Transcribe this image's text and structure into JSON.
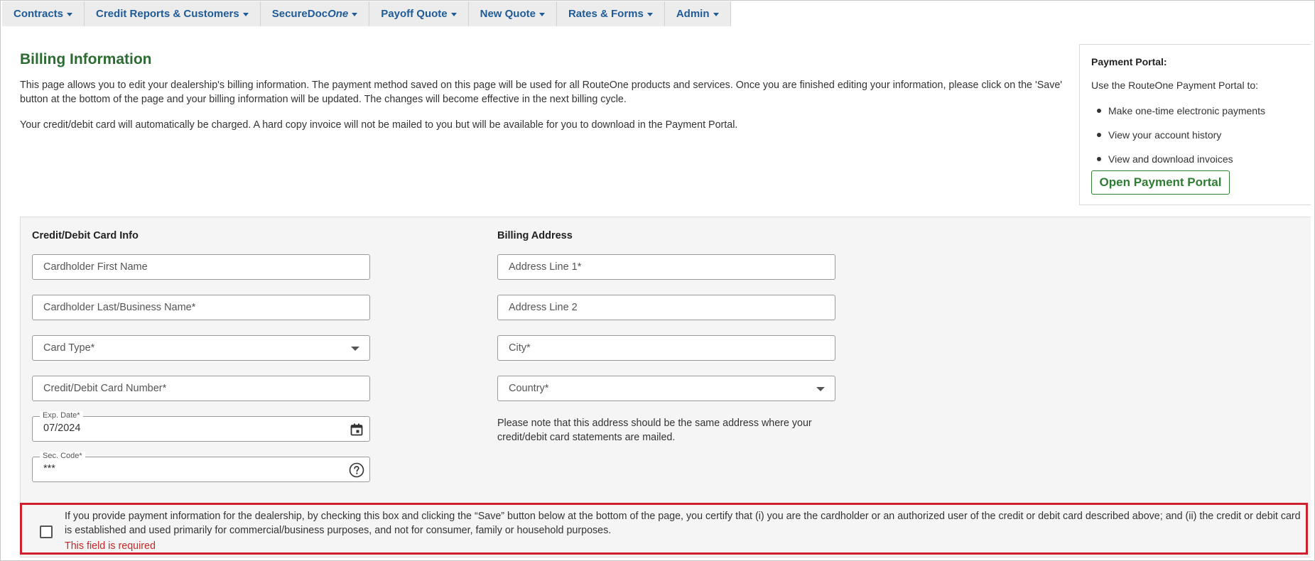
{
  "nav": [
    {
      "label": "Contracts"
    },
    {
      "label": "Credit Reports & Customers"
    },
    {
      "label_main": "SecureDoc",
      "label_italic": "One"
    },
    {
      "label": "Payoff Quote"
    },
    {
      "label": "New Quote"
    },
    {
      "label": "Rates & Forms"
    },
    {
      "label": "Admin"
    }
  ],
  "page": {
    "title": "Billing Information",
    "intro_1": "This page allows you to edit your dealership's billing information. The payment method saved on this page will be used for all RouteOne products and services. Once you are finished editing your information, please click on the 'Save' button at the bottom of the page and your billing information will be updated. The changes will become effective in the next billing cycle.",
    "intro_2": "Your credit/debit card will automatically be charged. A hard copy invoice will not be mailed to you but will be available for you to download in the Payment Portal."
  },
  "portal": {
    "title": "Payment Portal:",
    "text": "Use the RouteOne Payment Portal to:",
    "items": [
      "Make one-time electronic payments",
      "View your account history",
      "View and download invoices"
    ],
    "button": "Open Payment Portal"
  },
  "card": {
    "section_title": "Credit/Debit Card Info",
    "first_name_placeholder": "Cardholder First Name",
    "last_name_placeholder": "Cardholder Last/Business Name*",
    "card_type": "Card Type*",
    "card_number_placeholder": "Credit/Debit Card Number*",
    "exp_label": "Exp. Date*",
    "exp_value": "07/2024",
    "sec_label": "Sec. Code*",
    "sec_value": "***"
  },
  "address": {
    "section_title": "Billing Address",
    "line1_placeholder": "Address Line 1*",
    "line2_placeholder": "Address Line 2",
    "city_placeholder": "City*",
    "country": "Country*",
    "note": "Please note that this address should be the same address where your credit/debit card statements are mailed."
  },
  "certification": {
    "text": "If you provide payment information for the dealership, by checking this box and clicking the “Save” button below at the bottom of the page, you certify that (i) you are the cardholder or an authorized user of the credit or debit card described above; and (ii) the credit or debit card is established and used primarily for commercial/business purposes, and not for consumer, family or household purposes.",
    "error": "This field is required",
    "checked": false
  },
  "colors": {
    "nav_text": "#1f5b97",
    "title_green": "#2c6b32",
    "button_green": "#2e7d32",
    "error_red": "#c62828",
    "highlight_border": "#d0202d"
  }
}
